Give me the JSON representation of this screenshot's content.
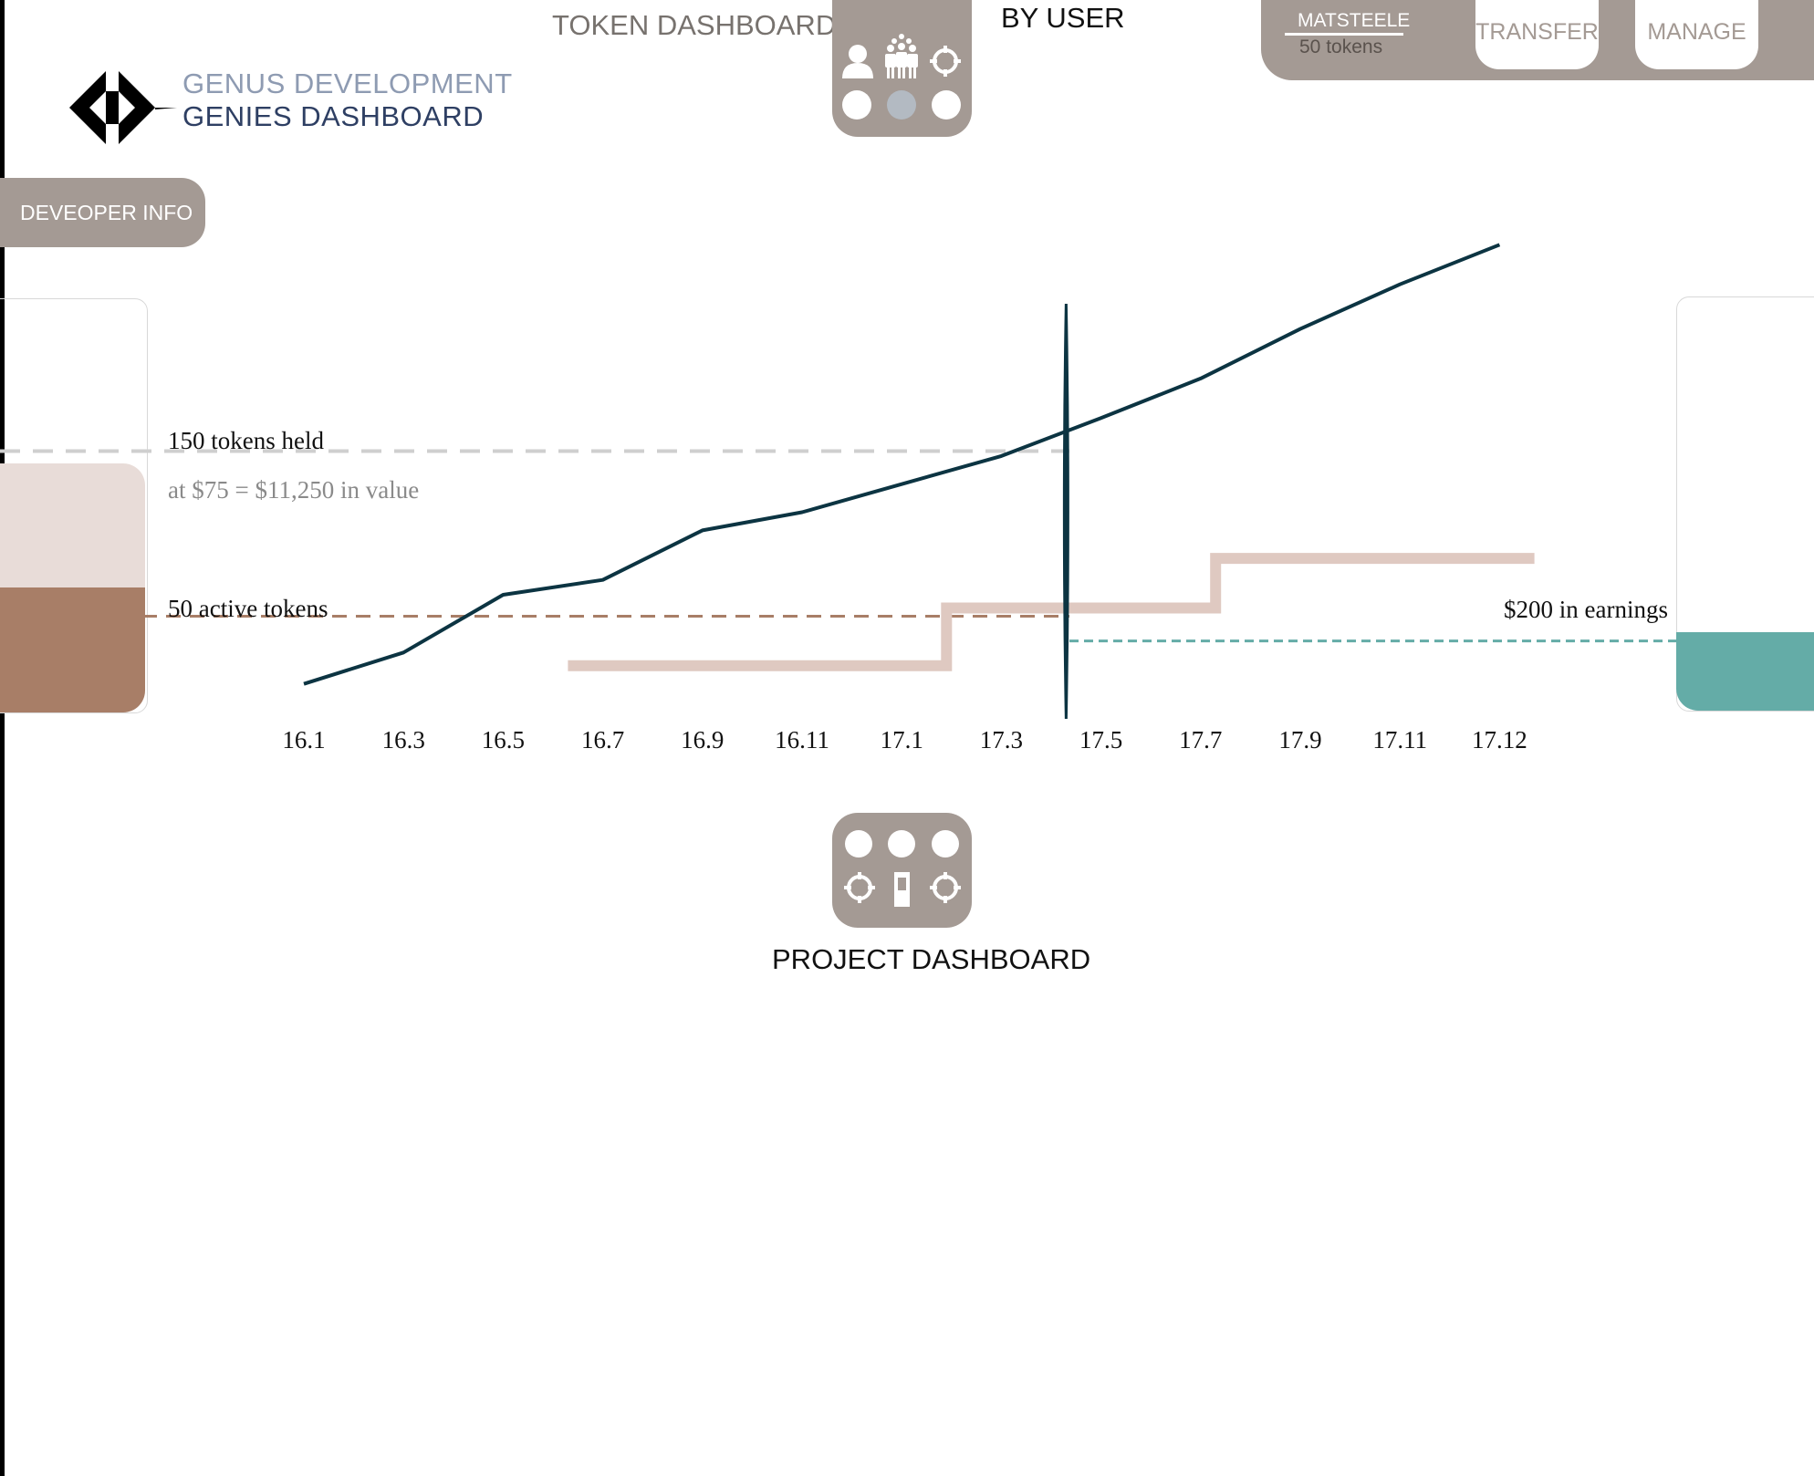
{
  "brand": {
    "line1": "GENUS DEVELOPMENT",
    "line2": "GENIES DASHBOARD"
  },
  "nav": {
    "token_dashboard_label": "TOKEN DASHBOARD:",
    "view_label": "BY USER",
    "project_dashboard_label": "PROJECT DASHBOARD"
  },
  "user": {
    "name": "MATSTEELE",
    "tokens": "50 tokens"
  },
  "actions": {
    "transfer": "TRANSFER",
    "manage": "MANAGE"
  },
  "developer_info": "DEVEOPER INFO",
  "colors": {
    "brand_dark": "#2e3f63",
    "panel_gray": "#a49a94",
    "line_dark": "#0c3442",
    "step_light": "#dfc9c1",
    "held_light": "#e8dcd8",
    "active_brown": "#a87e67",
    "earnings_teal": "#64aca7"
  },
  "annotations": {
    "held": "150 tokens held",
    "value": "at $75 = $11,250 in value",
    "active": "50 active tokens",
    "earnings": "$200 in earnings"
  },
  "chart_data": {
    "type": "line",
    "categories": [
      "16.1",
      "16.3",
      "16.5",
      "16.7",
      "16.9",
      "16.11",
      "17.1",
      "17.3",
      "17.5",
      "17.7",
      "17.9",
      "17.11",
      "17.12"
    ],
    "series": [
      {
        "style": "line",
        "values": [
          [
            0,
            9
          ],
          [
            1,
            28
          ],
          [
            2,
            63
          ],
          [
            3,
            72
          ],
          [
            4,
            102
          ],
          [
            5,
            113
          ],
          [
            6,
            130
          ],
          [
            7,
            147
          ],
          [
            8,
            170
          ],
          [
            9,
            194
          ],
          [
            10,
            224
          ],
          [
            11,
            251
          ],
          [
            12,
            275
          ]
        ]
      },
      {
        "style": "step",
        "values": [
          [
            2.65,
            20
          ],
          [
            6.45,
            20
          ],
          [
            6.45,
            55
          ],
          [
            9.15,
            55
          ],
          [
            9.15,
            85
          ],
          [
            12.35,
            85
          ]
        ]
      }
    ],
    "reference_lines": [
      {
        "y": 150,
        "style": "dashed"
      },
      {
        "y": 50,
        "style": "dashed"
      },
      {
        "y": 35,
        "style": "dashed"
      }
    ],
    "current_marker_x": 7.65,
    "ylim": [
      0,
      200
    ]
  }
}
